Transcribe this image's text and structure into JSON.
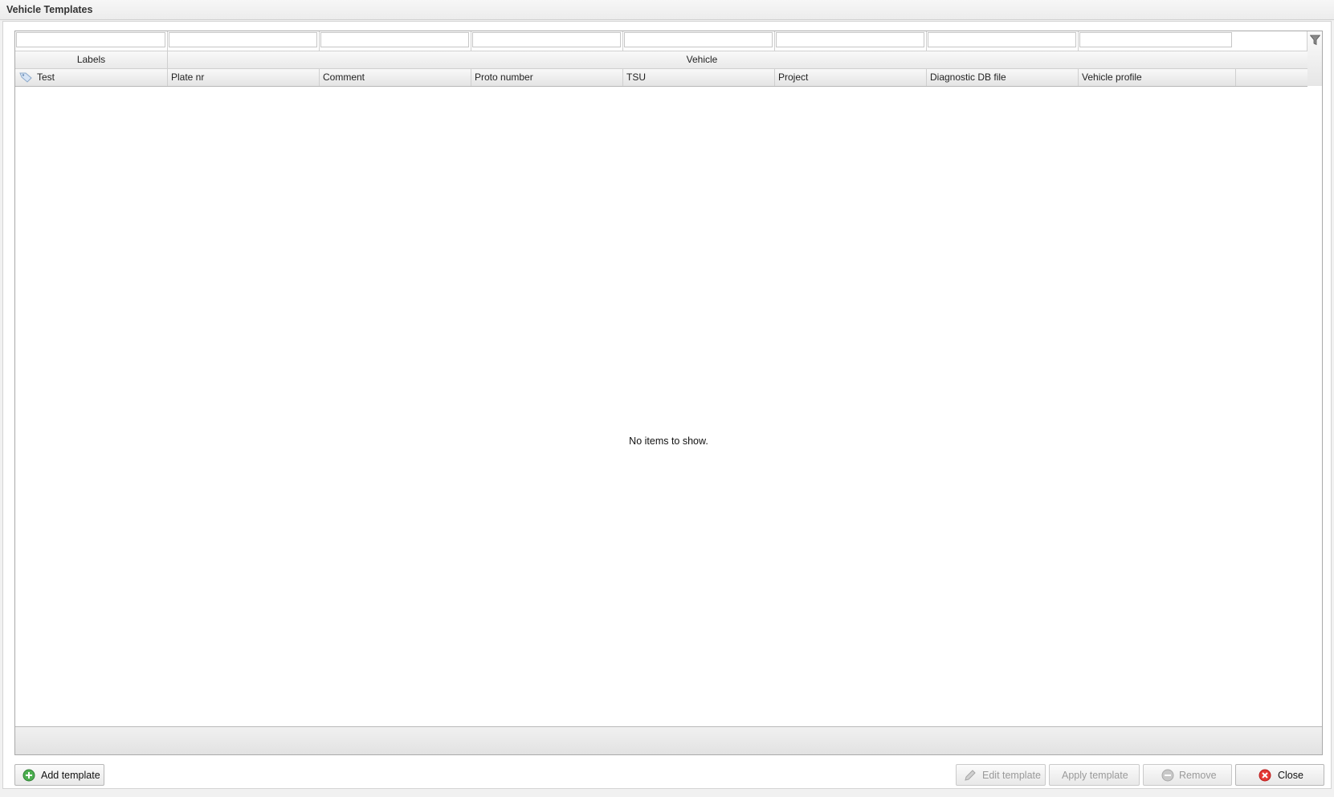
{
  "window": {
    "title": "Vehicle Templates"
  },
  "grid": {
    "group_headers": {
      "labels": "Labels",
      "vehicle": "Vehicle"
    },
    "columns": [
      "Test",
      "Plate nr",
      "Comment",
      "Proto number",
      "TSU",
      "Project",
      "Diagnostic DB file",
      "Vehicle profile"
    ],
    "filters": [
      "",
      "",
      "",
      "",
      "",
      "",
      "",
      ""
    ],
    "empty_message": "No items to show."
  },
  "buttons": {
    "add_template": "Add template",
    "edit_template": "Edit template",
    "apply_template": "Apply template",
    "remove": "Remove",
    "close": "Close"
  },
  "icons": {
    "filter": "funnel-icon",
    "label_column": "tag-icon",
    "add": "plus-circle-icon",
    "edit": "pencil-icon",
    "remove": "minus-circle-icon",
    "close": "close-circle-icon"
  },
  "colors": {
    "add": "#4caf50",
    "close": "#e53935",
    "disabled": "#9a9a9a"
  }
}
